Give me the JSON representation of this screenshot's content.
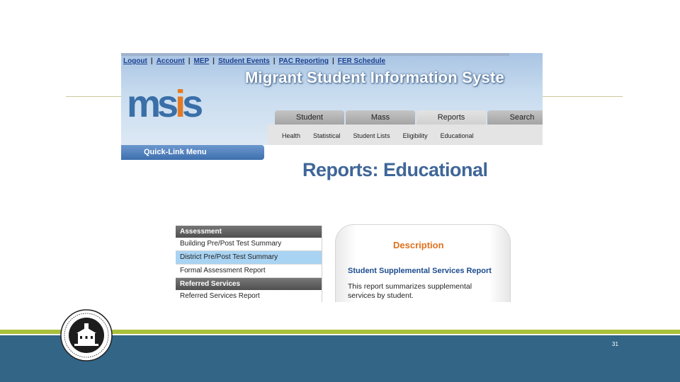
{
  "header": {
    "top_nav": [
      "Logout",
      "Account",
      "MEP",
      "Student Events",
      "PAC Reporting",
      "FER Schedule"
    ],
    "app_title": "Migrant Student Information Syste",
    "logo": {
      "m": "m",
      "s1": "s",
      "i": "i",
      "s2": "s"
    },
    "tabs": [
      "Student",
      "Mass",
      "Reports",
      "Search"
    ],
    "active_tab": "Reports",
    "subtabs": [
      "Health",
      "Statistical",
      "Student Lists",
      "Eligibility",
      "Educational"
    ]
  },
  "quicklink": {
    "label": "Quick-Link Menu"
  },
  "page_heading": "Reports: Educational",
  "report_menu": {
    "sections": [
      {
        "title": "Assessment",
        "items": [
          "Building Pre/Post Test Summary",
          "District Pre/Post Test Summary",
          "Formal Assessment Report"
        ]
      },
      {
        "title": "Referred Services",
        "items": [
          "Referred Services Report"
        ]
      }
    ],
    "selected_item": "District Pre/Post Test Summary"
  },
  "description": {
    "title": "Description",
    "report_name": "Student Supplemental Services Report",
    "body": "This report summarizes supplemental services by student."
  },
  "slide": {
    "page_number": "31"
  },
  "colors": {
    "accent_green": "#a9c03a",
    "footer_blue": "#336586",
    "selected_row": "#a9d3f2",
    "description_title": "#e0701d"
  }
}
